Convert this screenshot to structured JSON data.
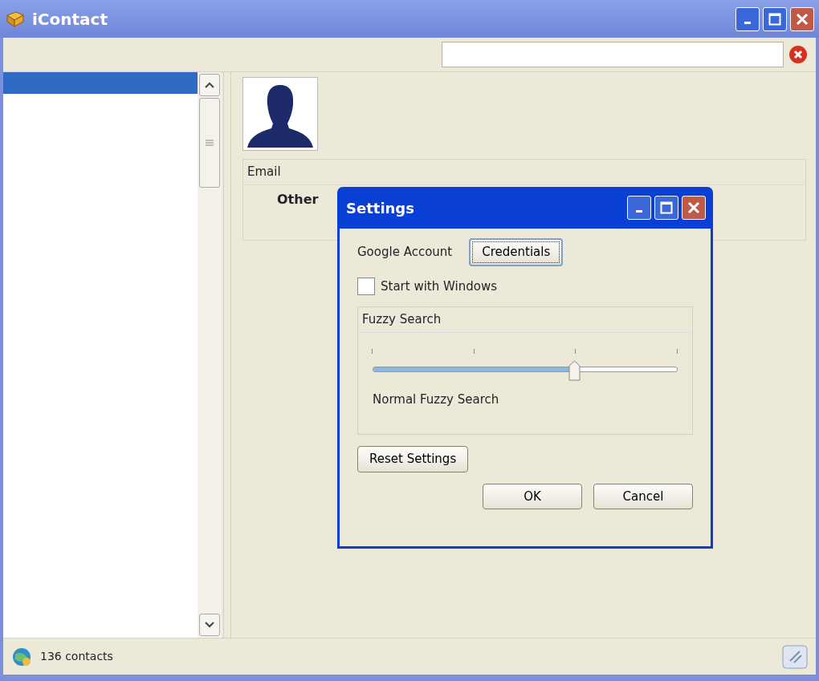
{
  "window": {
    "title": "iContact"
  },
  "contact_rows": [
    {
      "selected": true
    }
  ],
  "details": {
    "section_title": "Email",
    "label": "Other"
  },
  "status_bar": {
    "text": "136 contacts"
  },
  "settings_dialog": {
    "title": "Settings",
    "account_label": "Google Account",
    "credentials_button": "Credentials",
    "start_with_windows": {
      "label": "Start with Windows",
      "checked": false
    },
    "fuzzy_search": {
      "title": "Fuzzy Search",
      "level": 0.66,
      "reading": "Normal Fuzzy Search"
    },
    "reset_button": "Reset Settings",
    "buttons": [
      "OK",
      "Cancel"
    ]
  }
}
